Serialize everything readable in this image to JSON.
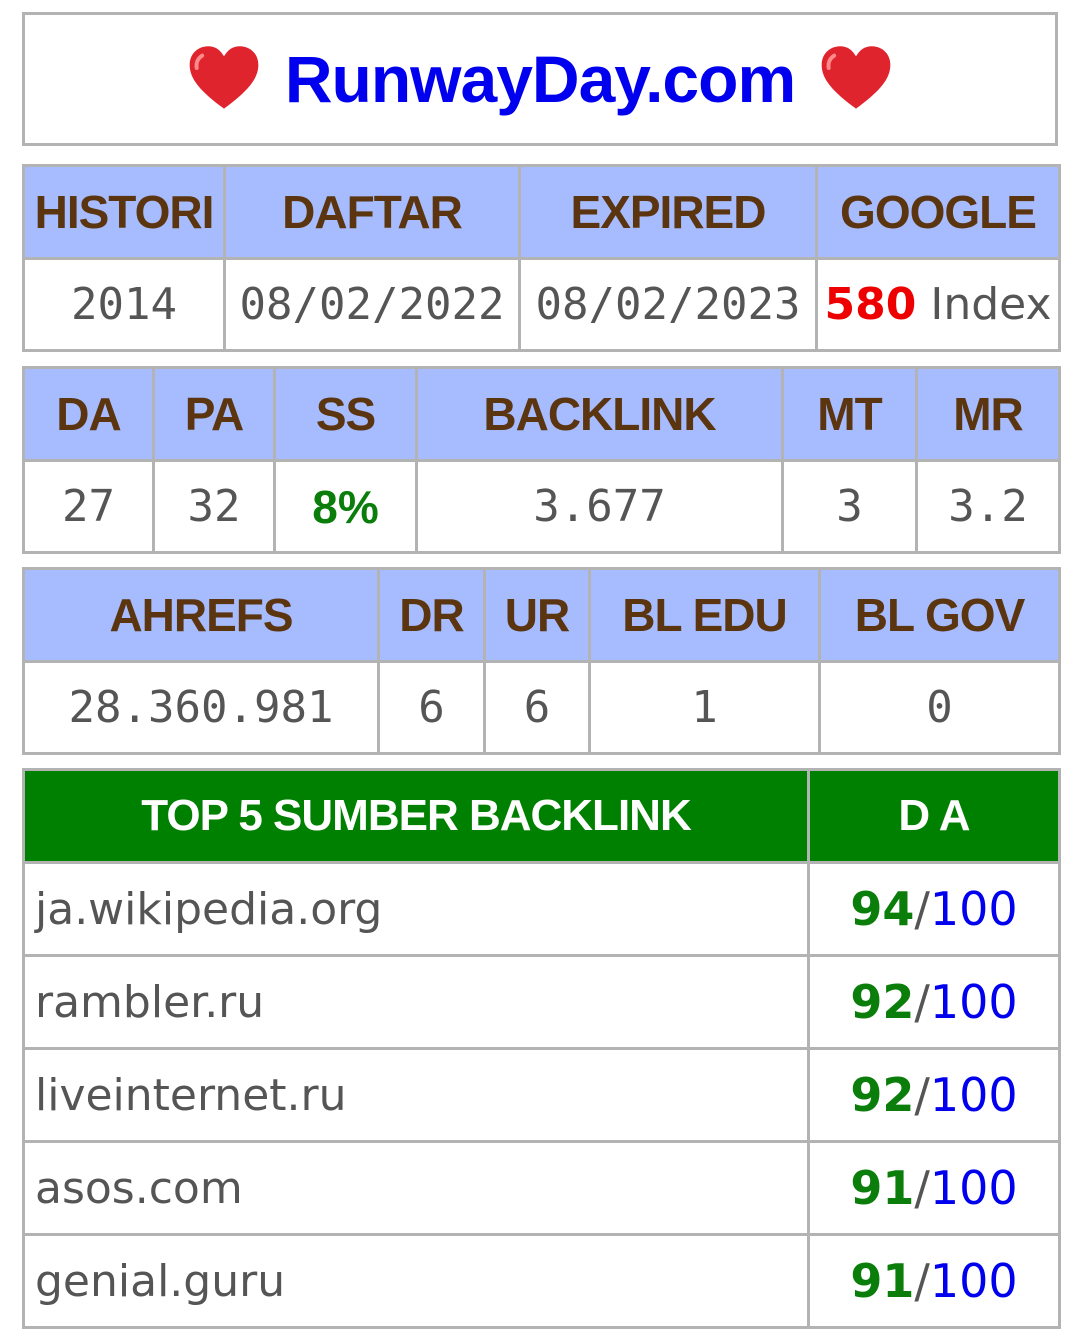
{
  "header": {
    "title": "RunwayDay.com",
    "left_icon": "heart-icon",
    "right_icon": "heart-icon"
  },
  "table1": {
    "headers": [
      "HISTORI",
      "DAFTAR",
      "EXPIRED",
      "GOOGLE"
    ],
    "histori": "2014",
    "daftar": "08/02/2022",
    "expired": "08/02/2023",
    "google_count": "580",
    "google_suffix": "Index"
  },
  "table2": {
    "headers": [
      "DA",
      "PA",
      "SS",
      "BACKLINK",
      "MT",
      "MR"
    ],
    "values": [
      "27",
      "32",
      "8%",
      "3.677",
      "3",
      "3.2"
    ]
  },
  "table3": {
    "headers": [
      "AHREFS",
      "DR",
      "UR",
      "BL EDU",
      "BL GOV"
    ],
    "values": [
      "28.360.981",
      "6",
      "6",
      "1",
      "0"
    ]
  },
  "top5": {
    "headers": [
      "TOP 5 SUMBER BACKLINK",
      "D A"
    ],
    "rows": [
      {
        "domain": "ja.wikipedia.org",
        "score": "94",
        "max": "100"
      },
      {
        "domain": "rambler.ru",
        "score": "92",
        "max": "100"
      },
      {
        "domain": "liveinternet.ru",
        "score": "92",
        "max": "100"
      },
      {
        "domain": "asos.com",
        "score": "91",
        "max": "100"
      },
      {
        "domain": "genial.guru",
        "score": "91",
        "max": "100"
      }
    ]
  },
  "colors": {
    "header_bg": "#a6bcff",
    "header_text": "#5b3510",
    "top5_bg": "#008000",
    "title": "#0000ee",
    "score_green": "#0a7d0a",
    "google_red": "#ee0000"
  }
}
